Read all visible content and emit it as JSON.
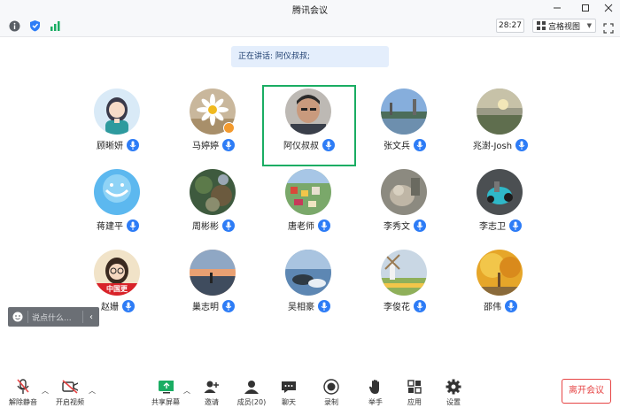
{
  "window": {
    "title": "腾讯会议"
  },
  "status": {
    "timer": "28:27",
    "view_label": "宫格视图"
  },
  "speaking": {
    "text": "正在讲话: 阿仪叔叔;"
  },
  "participants": [
    {
      "name": "顾晰妍",
      "mic_icon": "mic-on-icon"
    },
    {
      "name": "马婷婷",
      "mic_icon": "mic-on-icon"
    },
    {
      "name": "阿仪叔叔",
      "mic_icon": "mic-on-icon",
      "active": true
    },
    {
      "name": "张文兵",
      "mic_icon": "mic-on-icon"
    },
    {
      "name": "兆澍-Josh",
      "mic_icon": "mic-on-icon"
    },
    {
      "name": "蒋建平",
      "mic_icon": "mic-on-icon"
    },
    {
      "name": "周彬彬",
      "mic_icon": "mic-on-icon"
    },
    {
      "name": "唐老师",
      "mic_icon": "mic-on-icon"
    },
    {
      "name": "李秀文",
      "mic_icon": "mic-on-icon"
    },
    {
      "name": "李志卫",
      "mic_icon": "mic-on-icon"
    },
    {
      "name": "赵姗",
      "mic_icon": "mic-on-icon",
      "avatar_text": "中国更"
    },
    {
      "name": "巢志明",
      "mic_icon": "mic-on-icon"
    },
    {
      "name": "吴相豪",
      "mic_icon": "mic-on-icon"
    },
    {
      "name": "李俊花",
      "mic_icon": "mic-on-icon"
    },
    {
      "name": "邵伟",
      "mic_icon": "mic-on-icon"
    }
  ],
  "chat": {
    "placeholder": "说点什么..."
  },
  "toolbar": {
    "unmute": "解除静音",
    "start_video": "开启视频",
    "share_screen": "共享屏幕",
    "invite": "邀请",
    "members": "成员(20)",
    "chat": "聊天",
    "record": "录制",
    "raise_hand": "举手",
    "apps": "应用",
    "settings": "设置",
    "leave": "离开会议"
  },
  "colors": {
    "accent": "#2d7cf6",
    "active_border": "#1aad63",
    "leave": "#e64545",
    "banner": "#e4eefc"
  }
}
